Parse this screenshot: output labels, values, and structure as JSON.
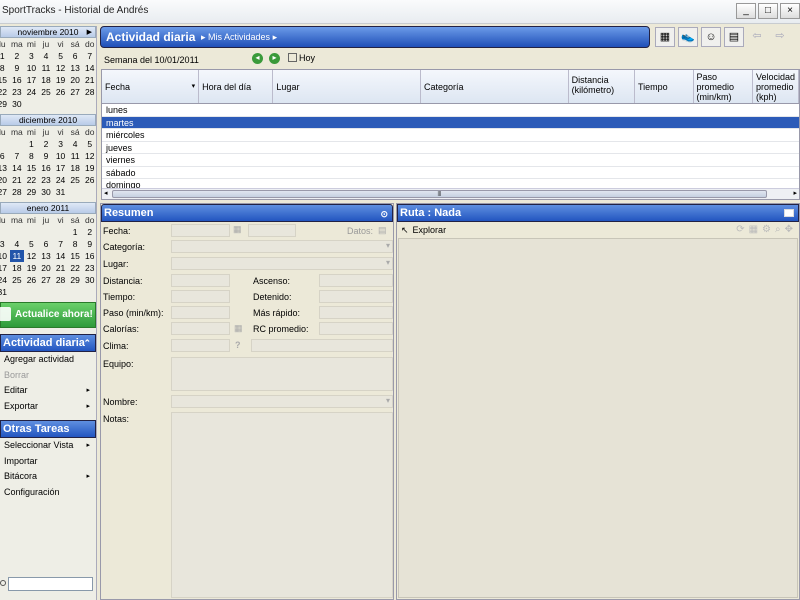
{
  "window": {
    "title": "SportTracks - Historial de Andrés",
    "min": "_",
    "max": "□",
    "close": "×"
  },
  "calendars": [
    {
      "month": "noviembre 2010",
      "dows": [
        "lu",
        "ma",
        "mi",
        "ju",
        "vi",
        "sá",
        "do"
      ],
      "days": [
        "1",
        "2",
        "3",
        "4",
        "5",
        "6",
        "7",
        "8",
        "9",
        "10",
        "11",
        "12",
        "13",
        "14",
        "15",
        "16",
        "17",
        "18",
        "19",
        "20",
        "21",
        "22",
        "23",
        "24",
        "25",
        "26",
        "27",
        "28",
        "29",
        "30",
        "",
        "",
        "",
        "",
        ""
      ]
    },
    {
      "month": "diciembre 2010",
      "dows": [
        "lu",
        "ma",
        "mi",
        "ju",
        "vi",
        "sá",
        "do"
      ],
      "days": [
        "",
        "",
        "1",
        "2",
        "3",
        "4",
        "5",
        "6",
        "7",
        "8",
        "9",
        "10",
        "11",
        "12",
        "13",
        "14",
        "15",
        "16",
        "17",
        "18",
        "19",
        "20",
        "21",
        "22",
        "23",
        "24",
        "25",
        "26",
        "27",
        "28",
        "29",
        "30",
        "31",
        "",
        ""
      ]
    },
    {
      "month": "enero 2011",
      "dows": [
        "lu",
        "ma",
        "mi",
        "ju",
        "vi",
        "sá",
        "do"
      ],
      "days": [
        "",
        "",
        "",
        "",
        "",
        "1",
        "2",
        "3",
        "4",
        "5",
        "6",
        "7",
        "8",
        "9",
        "10",
        "11",
        "12",
        "13",
        "14",
        "15",
        "16",
        "17",
        "18",
        "19",
        "20",
        "21",
        "22",
        "23",
        "24",
        "25",
        "26",
        "27",
        "28",
        "29",
        "30",
        "31",
        "",
        "",
        "",
        "",
        "",
        ""
      ],
      "selected": "11"
    }
  ],
  "update_label": "Actualice ahora!",
  "tasks_daily": {
    "title": "Actividad diaria",
    "items": [
      {
        "label": "Agregar actividad",
        "disabled": false,
        "sub": ""
      },
      {
        "label": "Borrar",
        "disabled": true,
        "sub": ""
      },
      {
        "label": "Editar",
        "disabled": false,
        "sub": "▸"
      },
      {
        "label": "Exportar",
        "disabled": false,
        "sub": "▸"
      }
    ]
  },
  "tasks_other": {
    "title": "Otras Tareas",
    "items": [
      {
        "label": "Seleccionar Vista",
        "sub": "▸"
      },
      {
        "label": "Importar",
        "sub": ""
      },
      {
        "label": "Bitácora",
        "sub": "▸"
      },
      {
        "label": "Configuración",
        "sub": ""
      }
    ]
  },
  "main": {
    "title": "Actividad diaria",
    "breadcrumb": "Mis Actividades",
    "week": "Semana del 10/01/2011",
    "today": "Hoy"
  },
  "grid": {
    "headers": [
      "Fecha",
      "Hora del día",
      "Lugar",
      "Categoría",
      "Distancia (kilómetro)",
      "Tiempo",
      "Paso promedio (min/km)",
      "Velocidad promedio (kph)"
    ],
    "rows": [
      "lunes",
      "martes",
      "miércoles",
      "jueves",
      "viernes",
      "sábado",
      "domingo"
    ],
    "selected_row": 1
  },
  "resumen": {
    "title": "Resumen",
    "fecha": "Fecha:",
    "datos": "Datos:",
    "categoria": "Categoría:",
    "lugar": "Lugar:",
    "distancia": "Distancia:",
    "ascenso": "Ascenso:",
    "tiempo": "Tiempo:",
    "detenido": "Detenido:",
    "paso": "Paso (min/km):",
    "mas_rapido": "Más rápido:",
    "calorias": "Calorías:",
    "rc": "RC promedio:",
    "clima": "Clima:",
    "equipo": "Equipo:",
    "nombre": "Nombre:",
    "notas": "Notas:"
  },
  "ruta": {
    "title": "Ruta : Nada",
    "explorar": "Explorar"
  }
}
